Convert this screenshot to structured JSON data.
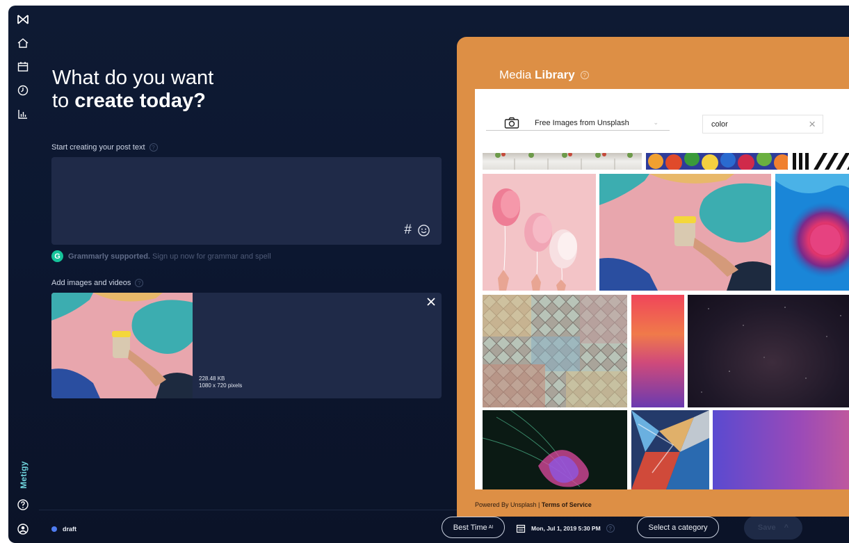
{
  "sidebar": {
    "brand_name": "Metigy",
    "icons": [
      "logo-icon",
      "home-icon",
      "calendar-icon",
      "clock-icon",
      "analytics-icon",
      "help-icon",
      "account-icon"
    ]
  },
  "composer": {
    "headline_line1": "What do you want",
    "headline_line2_prefix": "to",
    "headline_line2_bold": "create today?",
    "post_text_label": "Start creating your post text",
    "hashtag_symbol": "#",
    "grammarly_logo": "G",
    "grammarly_bold": "Grammarly supported.",
    "grammarly_text": "Sign up now for grammar and spell",
    "media_label": "Add images and videos",
    "media_size": "228.48 KB",
    "media_dimensions": "1080 x 720 pixels"
  },
  "bottom_bar": {
    "status_label": "draft",
    "best_time_label": "Best Time",
    "best_time_sup": "AI",
    "schedule_date": "Mon, Jul 1, 2019 5:30 PM",
    "category_label": "Select a category",
    "save_label": "Save",
    "save_caret": "^"
  },
  "media_library": {
    "title_prefix": "Media",
    "title_bold": "Library",
    "source_label": "Free Images from Unsplash",
    "source_caret": "⌄",
    "search_value": "color",
    "search_clear": "×",
    "footer_prefix": "Powered By Unsplash |",
    "footer_link": "Terms of Service"
  },
  "colors": {
    "app_background": "#0e1a33",
    "panel_orange": "#dd8f45",
    "field_background": "#1f2a48",
    "brand_teal": "#6fd3dc",
    "draft_dot": "#4f7cf0",
    "grammarly_green": "#15c39a"
  }
}
